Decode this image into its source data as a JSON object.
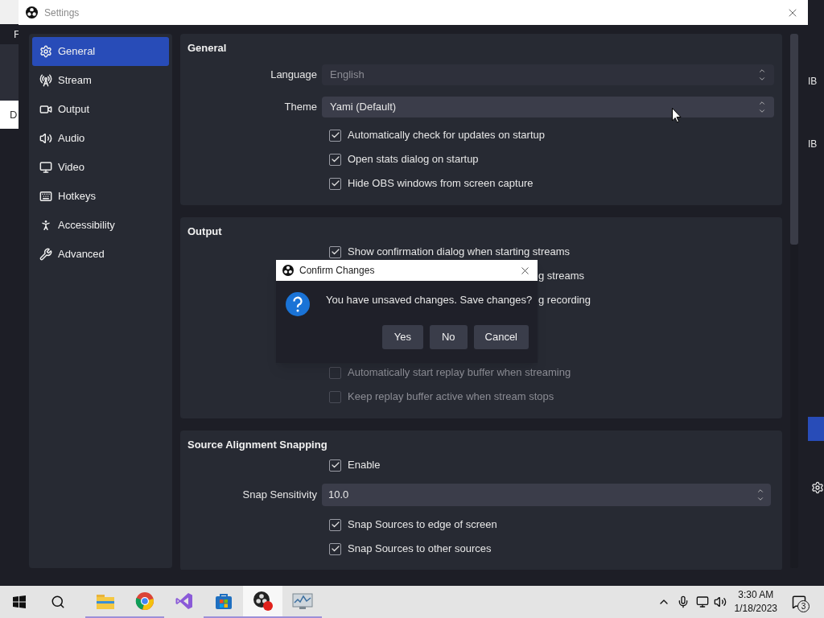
{
  "background_window": {
    "left_edge_texts": [
      "F",
      "D"
    ],
    "right_edge_texts": [
      "IB",
      "IB"
    ]
  },
  "settings_window": {
    "title": "Settings",
    "sidebar": [
      {
        "label": "General",
        "selected": true
      },
      {
        "label": "Stream",
        "selected": false
      },
      {
        "label": "Output",
        "selected": false
      },
      {
        "label": "Audio",
        "selected": false
      },
      {
        "label": "Video",
        "selected": false
      },
      {
        "label": "Hotkeys",
        "selected": false
      },
      {
        "label": "Accessibility",
        "selected": false
      },
      {
        "label": "Advanced",
        "selected": false
      }
    ],
    "sections": [
      {
        "title": "General",
        "rows": [
          {
            "kind": "combo",
            "label": "Language",
            "value": "English",
            "disabled": true
          },
          {
            "kind": "combo",
            "label": "Theme",
            "value": "Yami (Default)",
            "disabled": false
          },
          {
            "kind": "checkbox",
            "label": "Automatically check for updates on startup",
            "checked": true,
            "disabled": false
          },
          {
            "kind": "checkbox",
            "label": "Open stats dialog on startup",
            "checked": true,
            "disabled": false
          },
          {
            "kind": "checkbox",
            "label": "Hide OBS windows from screen capture",
            "checked": true,
            "disabled": false
          }
        ]
      },
      {
        "title": "Output",
        "rows": [
          {
            "kind": "checkbox",
            "label": "Show confirmation dialog when starting streams",
            "checked": true,
            "disabled": false
          },
          {
            "kind": "fragment",
            "text": "g streams"
          },
          {
            "kind": "fragment",
            "text": "g recording"
          },
          {
            "kind": "checkbox",
            "label": "Automatically start replay buffer when streaming",
            "checked": false,
            "disabled": true
          },
          {
            "kind": "checkbox",
            "label": "Keep replay buffer active when stream stops",
            "checked": false,
            "disabled": true
          }
        ]
      },
      {
        "title": "Source Alignment Snapping",
        "rows": [
          {
            "kind": "checkbox",
            "label": "Enable",
            "checked": true,
            "disabled": false
          },
          {
            "kind": "spin",
            "label": "Snap Sensitivity",
            "value": "10.0"
          },
          {
            "kind": "checkbox",
            "label": "Snap Sources to edge of screen",
            "checked": true,
            "disabled": false
          },
          {
            "kind": "checkbox",
            "label": "Snap Sources to other sources",
            "checked": true,
            "disabled": false
          }
        ]
      }
    ]
  },
  "dialog": {
    "title": "Confirm Changes",
    "message": "You have unsaved changes. Save changes?",
    "buttons": [
      "Yes",
      "No",
      "Cancel"
    ]
  },
  "taskbar": {
    "apps": [
      {
        "running": true,
        "selected": false
      },
      {
        "running": true,
        "selected": false
      },
      {
        "running": false,
        "selected": false
      },
      {
        "running": true,
        "selected": false
      },
      {
        "running": true,
        "selected": true
      },
      {
        "running": true,
        "selected": false
      }
    ],
    "time": "3:30 AM",
    "date": "1/18/2023",
    "notifications": "3"
  }
}
